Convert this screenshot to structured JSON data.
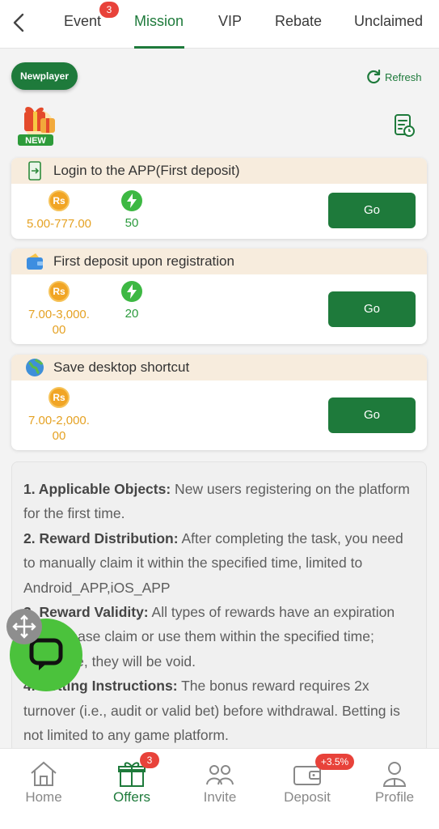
{
  "tabs": [
    {
      "label": "Event",
      "badge": "3"
    },
    {
      "label": "Mission",
      "active": true
    },
    {
      "label": "VIP"
    },
    {
      "label": "Rebate"
    },
    {
      "label": "Unclaimed"
    }
  ],
  "header": {
    "newplayer_label": "Newplayer",
    "refresh_label": "Refresh",
    "new_tag": "NEW"
  },
  "tasks": [
    {
      "title": "Login to the APP(First deposit)",
      "currency": "Rs",
      "amount": "5.00-777.00",
      "points": "50",
      "button": "Go"
    },
    {
      "title": "First deposit upon registration",
      "currency": "Rs",
      "amount_line1": "7.00-3,000.",
      "amount_line2": "00",
      "points": "20",
      "button": "Go"
    },
    {
      "title": "Save desktop shortcut",
      "currency": "Rs",
      "amount_line1": "7.00-2,000.",
      "amount_line2": "00",
      "button": "Go"
    }
  ],
  "rules": [
    {
      "heading": "1. Applicable Objects:",
      "text": " New users registering on the platform for the first time."
    },
    {
      "heading": "2. Reward Distribution:",
      "text": " After completing the task, you need to manually claim it within the specified time, limited to Android_APP,iOS_APP"
    },
    {
      "heading": "3. Reward Validity:",
      "text": " All types of rewards have an expiration date, please claim or use them within the specified time; otherwise, they will be void."
    },
    {
      "heading": "4. Betting Instructions:",
      "text": " The bonus reward requires 2x turnover (i.e., audit or valid bet) before withdrawal. Betting is not limited to any game platform."
    }
  ],
  "bottom_nav": [
    {
      "label": "Home"
    },
    {
      "label": "Offers",
      "badge": "3",
      "active": true
    },
    {
      "label": "Invite"
    },
    {
      "label": "Deposit",
      "badge": "+3.5%"
    },
    {
      "label": "Profile"
    }
  ],
  "colors": {
    "accent": "#1e7a3b",
    "gold": "#e5a224",
    "badge": "#e8423a",
    "chat": "#4bc23c"
  },
  "icons": [
    "back-icon",
    "refresh-icon",
    "gift-icon",
    "record-icon",
    "phone-icon",
    "wallet-icon",
    "globe-icon",
    "coin-icon",
    "bolt-icon",
    "move-icon",
    "chat-icon",
    "home-icon",
    "offers-icon",
    "invite-icon",
    "deposit-icon",
    "profile-icon"
  ]
}
